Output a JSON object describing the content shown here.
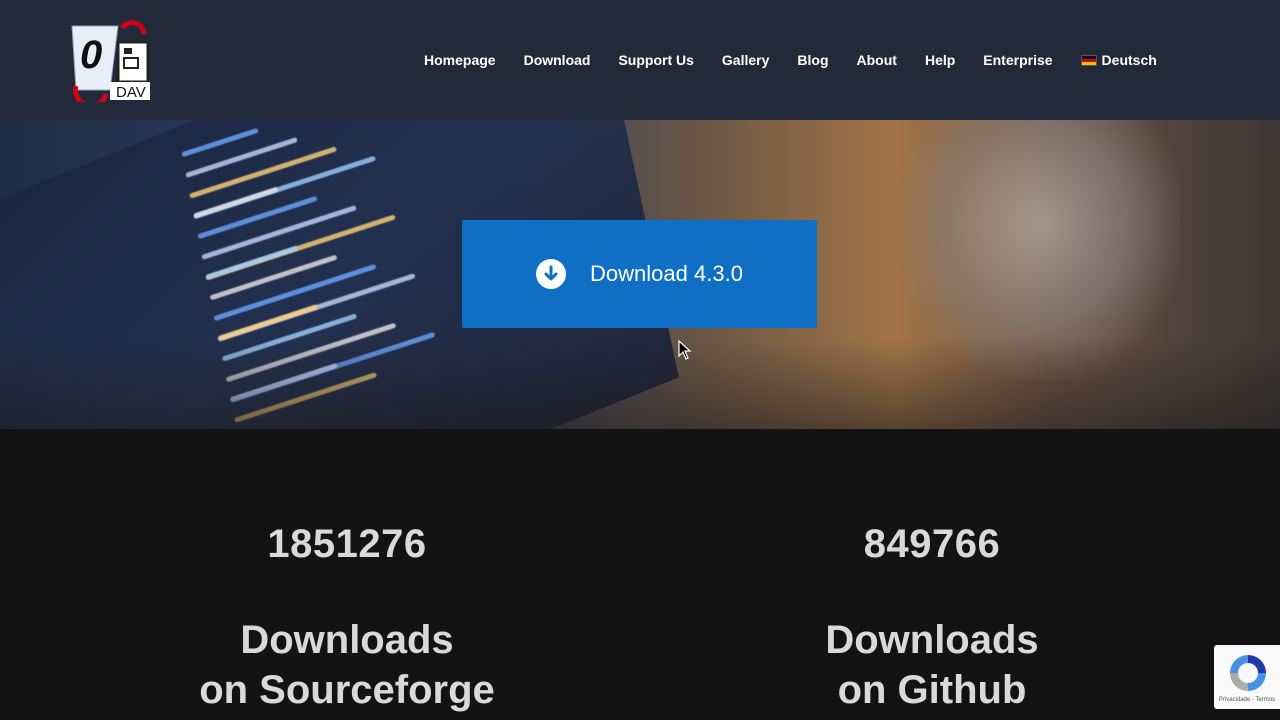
{
  "header": {
    "logo": {
      "text_top": "0",
      "text_bottom": "DAV"
    },
    "nav": [
      {
        "label": "Homepage"
      },
      {
        "label": "Download"
      },
      {
        "label": "Support Us"
      },
      {
        "label": "Gallery"
      },
      {
        "label": "Blog"
      },
      {
        "label": "About"
      },
      {
        "label": "Help"
      },
      {
        "label": "Enterprise"
      },
      {
        "label": "Deutsch",
        "icon": "german-flag-icon"
      }
    ]
  },
  "hero": {
    "download_button": {
      "label": "Download 4.3.0",
      "icon": "download-arrow-icon",
      "color": "#0e6fc4"
    }
  },
  "stats": [
    {
      "count": "1851276",
      "label_line1": "Downloads",
      "label_line2": "on Sourceforge"
    },
    {
      "count": "849766",
      "label_line1": "Downloads",
      "label_line2": "on Github"
    }
  ],
  "recaptcha": {
    "text": "Privacidade - Termos"
  },
  "colors": {
    "header_bg": "#222a3a",
    "body_bg": "#131313",
    "accent": "#0e6fc4"
  }
}
